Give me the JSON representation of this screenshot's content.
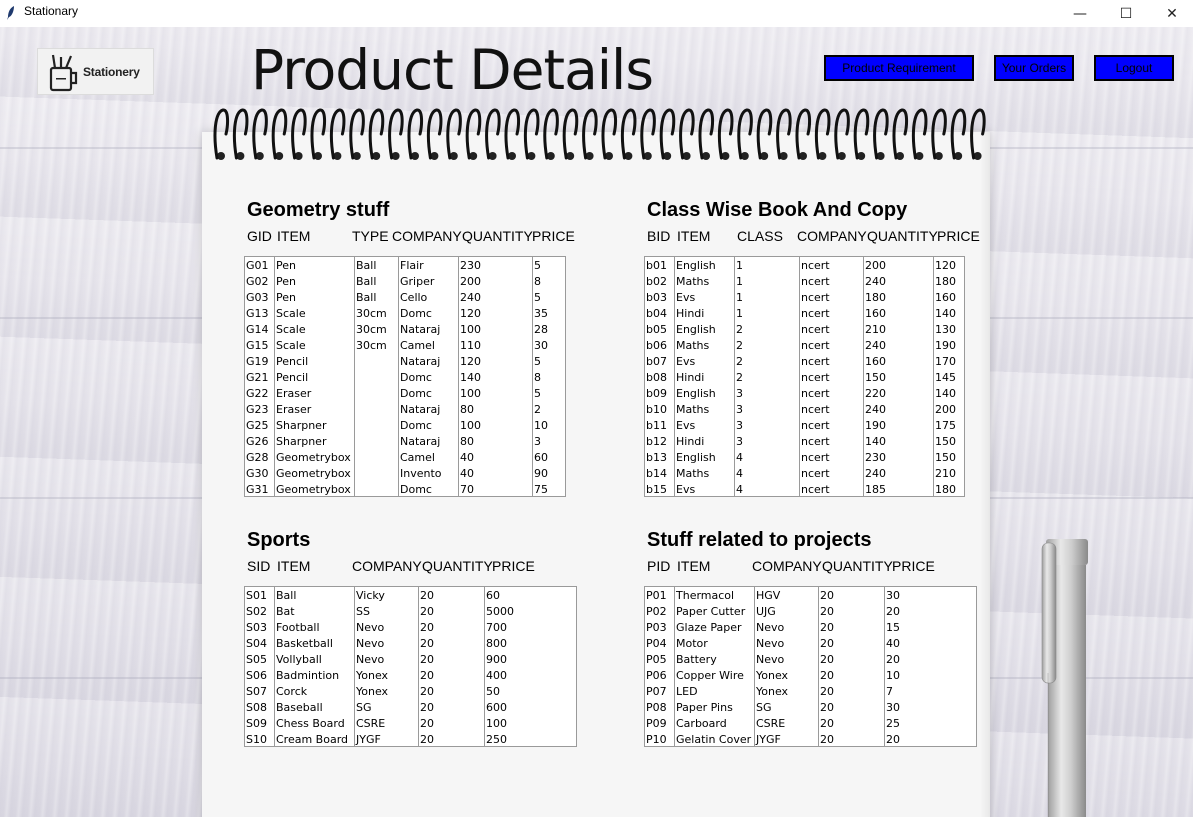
{
  "window": {
    "title": "Stationary",
    "minimize": "—",
    "maximize": "☐",
    "close": "✕"
  },
  "logo": {
    "text": "Stationery"
  },
  "header": {
    "title": "Product Details"
  },
  "nav": {
    "product_requirement": "Product Requirement",
    "your_orders": "Your Orders",
    "logout": "Logout"
  },
  "colors": {
    "nav_button": "#0000ff"
  },
  "geometry": {
    "title": "Geometry stuff",
    "headers": [
      "GID",
      "ITEM",
      "TYPE",
      "COMPANY",
      "QUANTITY",
      "PRICE"
    ],
    "columns": [
      [
        "G01",
        "G02",
        "G03",
        "G13",
        "G14",
        "G15",
        "G19",
        "G21",
        "G22",
        "G23",
        "G25",
        "G26",
        "G28",
        "G30",
        "G31"
      ],
      [
        "Pen",
        "Pen",
        "Pen",
        "Scale",
        "Scale",
        "Scale",
        "Pencil",
        "Pencil",
        "Eraser",
        "Eraser",
        "Sharpner",
        "Sharpner",
        "Geometrybox",
        "Geometrybox",
        "Geometrybox"
      ],
      [
        "Ball",
        "Ball",
        "Ball",
        "30cm",
        "30cm",
        "30cm",
        "",
        "",
        "",
        "",
        "",
        "",
        "",
        "",
        ""
      ],
      [
        "Flair",
        "Griper",
        "Cello",
        "Domc",
        "Nataraj",
        "Camel",
        "Nataraj",
        "Domc",
        "Domc",
        "Nataraj",
        "Domc",
        "Nataraj",
        "Camel",
        "Invento",
        "Domc"
      ],
      [
        "230",
        "200",
        "240",
        "120",
        "100",
        "110",
        "120",
        "140",
        "100",
        "80",
        "100",
        "80",
        "40",
        "40",
        "70"
      ],
      [
        "5",
        "8",
        "5",
        "35",
        "28",
        "30",
        "5",
        "8",
        "5",
        "2",
        "10",
        "3",
        "60",
        "90",
        "75"
      ]
    ]
  },
  "books": {
    "title": "Class Wise Book And Copy",
    "headers": [
      "BID",
      "ITEM",
      "CLASS",
      "COMPANY",
      "QUANTITY",
      "PRICE"
    ],
    "columns": [
      [
        "b01",
        "b02",
        "b03",
        "b04",
        "b05",
        "b06",
        "b07",
        "b08",
        "b09",
        "b10",
        "b11",
        "b12",
        "b13",
        "b14",
        "b15"
      ],
      [
        "English",
        "Maths",
        "Evs",
        "Hindi",
        "English",
        "Maths",
        "Evs",
        "Hindi",
        "English",
        "Maths",
        "Evs",
        "Hindi",
        "English",
        "Maths",
        "Evs"
      ],
      [
        "1",
        "1",
        "1",
        "1",
        "2",
        "2",
        "2",
        "2",
        "3",
        "3",
        "3",
        "3",
        "4",
        "4",
        "4"
      ],
      [
        "ncert",
        "ncert",
        "ncert",
        "ncert",
        "ncert",
        "ncert",
        "ncert",
        "ncert",
        "ncert",
        "ncert",
        "ncert",
        "ncert",
        "ncert",
        "ncert",
        "ncert"
      ],
      [
        "200",
        "240",
        "180",
        "160",
        "210",
        "240",
        "160",
        "150",
        "220",
        "240",
        "190",
        "140",
        "230",
        "240",
        "185"
      ],
      [
        "120",
        "180",
        "160",
        "140",
        "130",
        "190",
        "170",
        "145",
        "140",
        "200",
        "175",
        "150",
        "150",
        "210",
        "180"
      ]
    ]
  },
  "sports": {
    "title": "Sports",
    "headers": [
      "SID",
      "ITEM",
      "COMPANY",
      "QUANTITY",
      "PRICE"
    ],
    "columns": [
      [
        "S01",
        "S02",
        "S03",
        "S04",
        "S05",
        "S06",
        "S07",
        "S08",
        "S09",
        "S10"
      ],
      [
        "Ball",
        "Bat",
        "Football",
        "Basketball",
        "Vollyball",
        "Badmintion",
        "Corck",
        "Baseball",
        "Chess Board",
        "Cream Board"
      ],
      [
        "Vicky",
        "SS",
        "Nevo",
        "Nevo",
        "Nevo",
        "Yonex",
        "Yonex",
        "SG",
        "CSRE",
        "JYGF"
      ],
      [
        "20",
        "20",
        "20",
        "20",
        "20",
        "20",
        "20",
        "20",
        "20",
        "20"
      ],
      [
        "60",
        "5000",
        "700",
        "800",
        "900",
        "400",
        "50",
        "600",
        "100",
        "250"
      ]
    ]
  },
  "projects": {
    "title": "Stuff related to projects",
    "headers": [
      "PID",
      "ITEM",
      "COMPANY",
      "QUANTITY",
      "PRICE"
    ],
    "columns": [
      [
        "P01",
        "P02",
        "P03",
        "P04",
        "P05",
        "P06",
        "P07",
        "P08",
        "P09",
        "P10"
      ],
      [
        "Thermacol",
        "Paper Cutter",
        "Glaze Paper",
        "Motor",
        "Battery",
        "Copper Wire",
        "LED",
        "Paper Pins",
        "Carboard",
        "Gelatin Cover"
      ],
      [
        "HGV",
        "UJG",
        "Nevo",
        "Nevo",
        "Nevo",
        "Yonex",
        "Yonex",
        "SG",
        "CSRE",
        "JYGF"
      ],
      [
        "20",
        "20",
        "20",
        "20",
        "20",
        "20",
        "20",
        "20",
        "20",
        "20"
      ],
      [
        "30",
        "20",
        "15",
        "40",
        "20",
        "10",
        "7",
        "30",
        "25",
        "20"
      ]
    ]
  }
}
